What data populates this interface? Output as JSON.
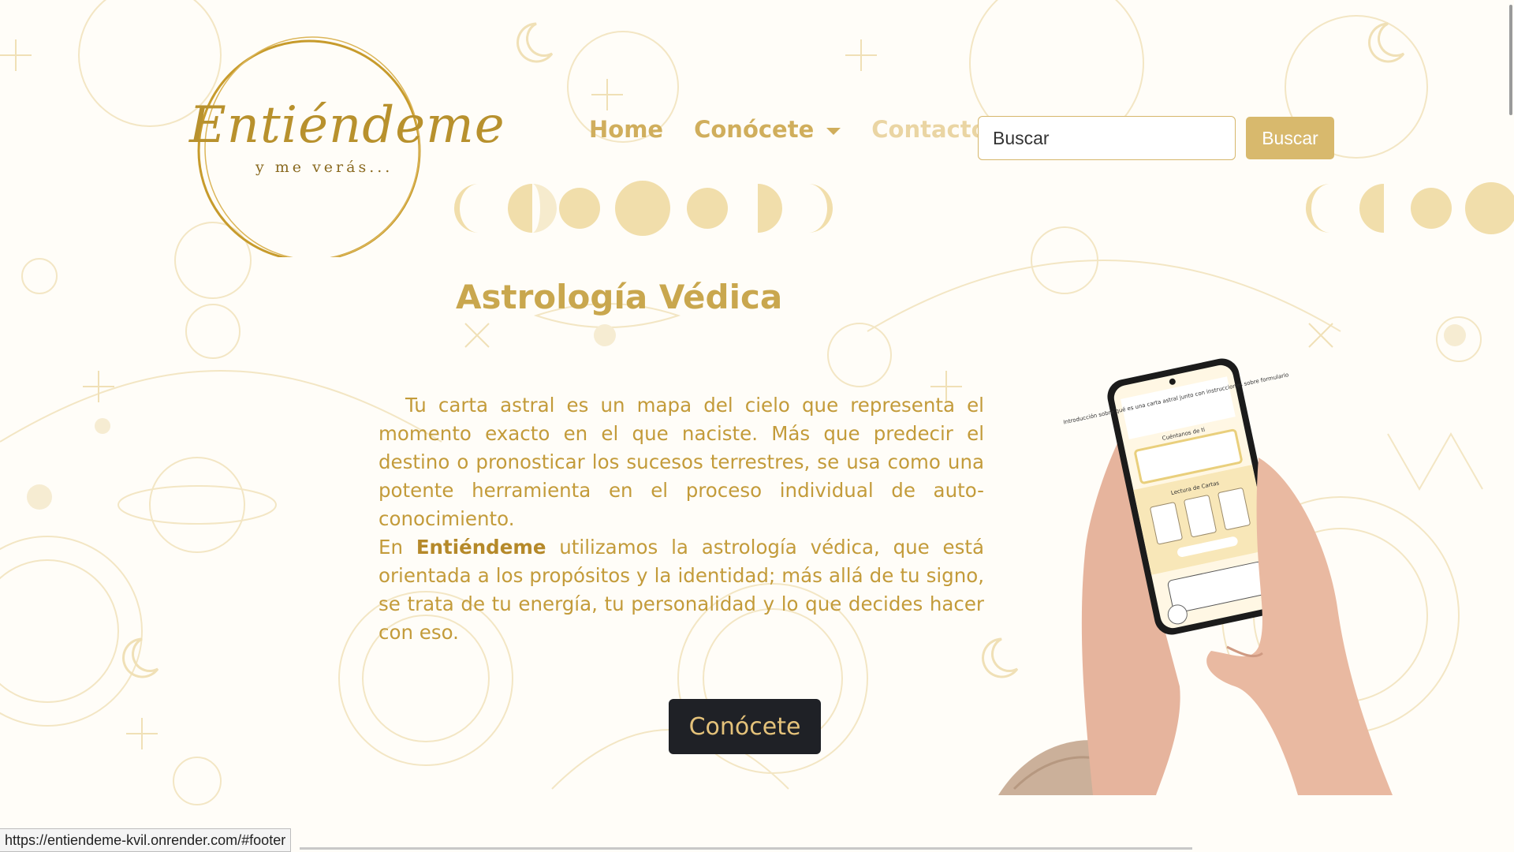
{
  "logo": {
    "script": "Entiéndeme",
    "tagline": "y me verás..."
  },
  "nav": {
    "home": "Home",
    "conocete": "Conócete",
    "contacto": "Contacto"
  },
  "search": {
    "placeholder": "Buscar",
    "button": "Buscar"
  },
  "main": {
    "title": "Astrología Védica",
    "p1": "Tu carta astral es un mapa del cielo que representa el momento exacto en el que naciste. Más que predecir el destino o pronosticar los sucesos terrestres, se usa como una potente herramienta en el proceso individual de auto-conocimiento.",
    "p2_prefix": "En ",
    "p2_bold": "Entiéndeme",
    "p2_suffix": " utilizamos la astrología védica, que está orientada a los propósitos y la identidad; más allá de tu signo, se trata de tu energía, tu personalidad y lo que decides hacer con eso.",
    "cta": "Conócete"
  },
  "phone_screen": {
    "intro": "Introducción sobre qué es una carta astral junto con instrucciones sobre formulario",
    "form_title": "Cuéntanos de ti",
    "cards_title": "Lectura de Cartas"
  },
  "status_bar": {
    "url": "https://entiendeme-kvil.onrender.com/#footer"
  },
  "colors": {
    "gold": "#c9a74e",
    "nav_gold": "#d0ae5c",
    "button_gold": "#d8b96d",
    "cta_dark": "#1f2126",
    "background": "#fffdf8"
  }
}
